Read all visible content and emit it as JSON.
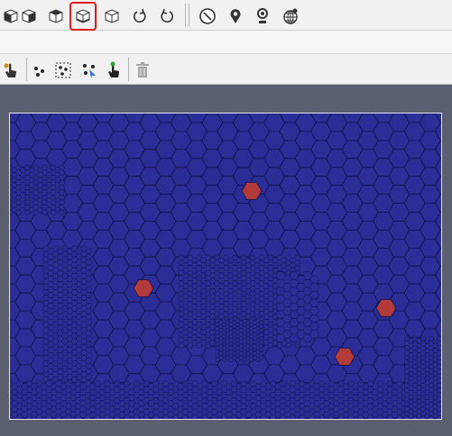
{
  "toolbar_top": {
    "buttons": [
      {
        "name": "view-cube-front-icon",
        "active": false
      },
      {
        "name": "view-cube-back-icon",
        "active": false
      },
      {
        "name": "view-cube-side-icon",
        "active": false
      },
      {
        "name": "view-cube-isometric-icon",
        "active": true
      },
      {
        "name": "view-cube-top-icon",
        "active": false
      },
      {
        "name": "rotate-cw-icon",
        "active": false
      },
      {
        "name": "rotate-ccw-icon",
        "active": false
      },
      {
        "name": "compass-icon",
        "active": false
      },
      {
        "name": "map-pin-icon",
        "active": false
      },
      {
        "name": "location-marker-icon",
        "active": false
      },
      {
        "name": "globe-pin-icon",
        "active": false
      }
    ]
  },
  "toolbar_tools": {
    "buttons": [
      {
        "name": "pointer-hand-icon",
        "enabled": true
      },
      {
        "name": "add-points-icon",
        "enabled": true
      },
      {
        "name": "select-points-icon",
        "enabled": true
      },
      {
        "name": "move-points-icon",
        "enabled": true
      },
      {
        "name": "place-marker-icon",
        "enabled": true
      },
      {
        "name": "delete-icon",
        "enabled": false
      }
    ]
  },
  "viewport": {
    "mesh_color": "#2b2e96",
    "edge_color": "#11124a",
    "highlight_color": "#b23a3a",
    "highlighted_cells": 4
  }
}
